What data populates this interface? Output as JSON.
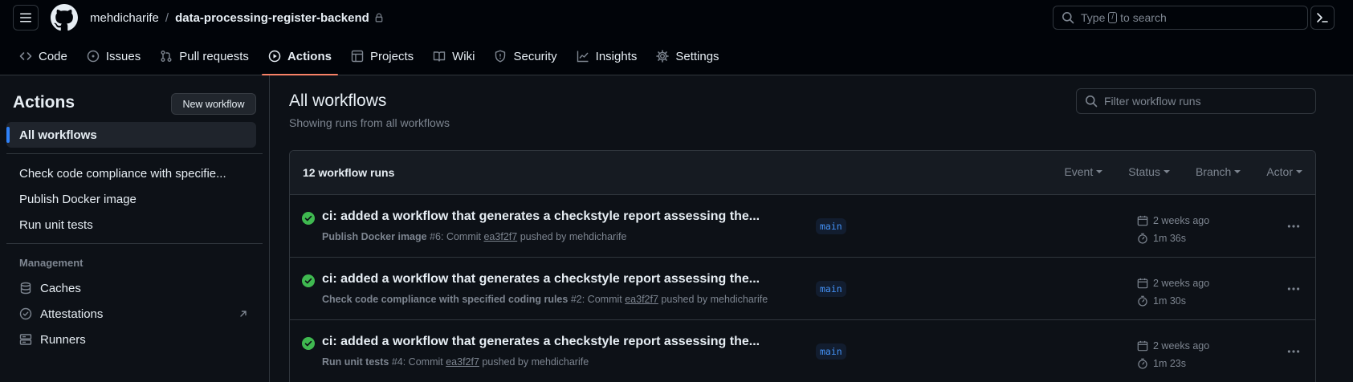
{
  "header": {
    "owner": "mehdicharife",
    "separator": "/",
    "repo": "data-processing-register-backend",
    "search_prefix": "Type",
    "search_key": "/",
    "search_suffix": "to search"
  },
  "tabs": [
    {
      "label": "Code",
      "icon": "code-icon"
    },
    {
      "label": "Issues",
      "icon": "issue-opened-icon"
    },
    {
      "label": "Pull requests",
      "icon": "git-pull-request-icon"
    },
    {
      "label": "Actions",
      "icon": "play-icon",
      "active": true
    },
    {
      "label": "Projects",
      "icon": "table-icon"
    },
    {
      "label": "Wiki",
      "icon": "book-icon"
    },
    {
      "label": "Security",
      "icon": "shield-icon"
    },
    {
      "label": "Insights",
      "icon": "graph-icon"
    },
    {
      "label": "Settings",
      "icon": "gear-icon"
    }
  ],
  "sidebar": {
    "title": "Actions",
    "new_workflow": "New workflow",
    "all_workflows": "All workflows",
    "workflows": [
      "Check code compliance with specifie...",
      "Publish Docker image",
      "Run unit tests"
    ],
    "management_heading": "Management",
    "management": [
      {
        "label": "Caches",
        "icon": "database-icon"
      },
      {
        "label": "Attestations",
        "icon": "verified-icon"
      },
      {
        "label": "Runners",
        "icon": "server-icon"
      }
    ]
  },
  "main": {
    "title": "All workflows",
    "subtitle": "Showing runs from all workflows",
    "filter_placeholder": "Filter workflow runs",
    "runs_count": "12 workflow runs",
    "filters": [
      "Event",
      "Status",
      "Branch",
      "Actor"
    ],
    "runs": [
      {
        "title": "ci: added a workflow that generates a checkstyle report assessing the...",
        "workflow": "Publish Docker image",
        "number": "#6: Commit",
        "sha": "ea3f2f7",
        "pushed_by": "pushed by mehdicharife",
        "branch": "main",
        "when": "2 weeks ago",
        "duration": "1m 36s"
      },
      {
        "title": "ci: added a workflow that generates a checkstyle report assessing the...",
        "workflow": "Check code compliance with specified coding rules",
        "number": "#2: Commit",
        "sha": "ea3f2f7",
        "pushed_by": "pushed by mehdicharife",
        "branch": "main",
        "when": "2 weeks ago",
        "duration": "1m 30s"
      },
      {
        "title": "ci: added a workflow that generates a checkstyle report assessing the...",
        "workflow": "Run unit tests",
        "number": "#4: Commit",
        "sha": "ea3f2f7",
        "pushed_by": "pushed by mehdicharife",
        "branch": "main",
        "when": "2 weeks ago",
        "duration": "1m 23s"
      }
    ]
  },
  "colors": {
    "background": "#0d1117",
    "header_bg": "#010409",
    "accent_tab": "#f78166",
    "success": "#3fb950",
    "link": "#4493f8"
  }
}
